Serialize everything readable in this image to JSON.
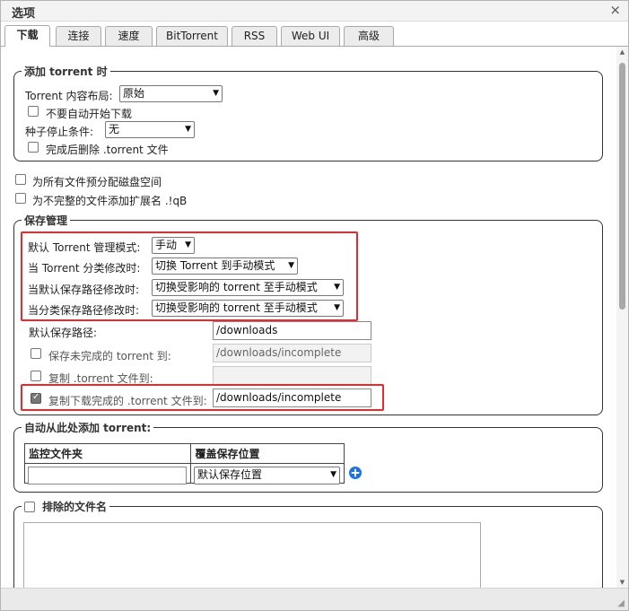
{
  "dialog": {
    "title": "选项",
    "close_glyph": "×"
  },
  "tabs": [
    "下载",
    "连接",
    "速度",
    "BitTorrent",
    "RSS",
    "Web UI",
    "高级"
  ],
  "add_torrent": {
    "legend": "添加 torrent 时",
    "layout_label": "Torrent 内容布局:",
    "layout_value": "原始",
    "no_autostart_label": "不要自动开始下载",
    "stop_condition_label": "种子停止条件:",
    "stop_condition_value": "无",
    "delete_after_label": "完成后删除 .torrent 文件"
  },
  "preallocate_label": "为所有文件预分配磁盘空间",
  "append_qb_label": "为不完整的文件添加扩展名 .!qB",
  "save_mgmt": {
    "legend": "保存管理",
    "default_mode_label": "默认 Torrent 管理模式:",
    "default_mode_value": "手动",
    "category_changed_label": "当 Torrent 分类修改时:",
    "category_changed_value": "切换 Torrent 到手动模式",
    "default_path_changed_label": "当默认保存路径修改时:",
    "default_path_changed_value": "切换受影响的 torrent 至手动模式",
    "category_path_changed_label": "当分类保存路径修改时:",
    "category_path_changed_value": "切换受影响的 torrent 至手动模式",
    "default_save_path_label": "默认保存路径:",
    "default_save_path_value": "/downloads",
    "incomplete_label": "保存未完成的 torrent 到:",
    "incomplete_value": "/downloads/incomplete",
    "copy_torrent_label": "复制 .torrent 文件到:",
    "copy_torrent_value": "",
    "copy_finished_label": "复制下载完成的 .torrent 文件到:",
    "copy_finished_value": "/downloads/incomplete"
  },
  "auto_add": {
    "legend": "自动从此处添加 torrent:",
    "col_watch": "监控文件夹",
    "col_override": "覆盖保存位置",
    "override_value": "默认保存位置"
  },
  "excluded": {
    "legend": "排除的文件名"
  },
  "icons": {
    "arrow": "▼",
    "scroll_up": "▲",
    "scroll_down": "▼",
    "add": "+",
    "grip": "◢"
  }
}
